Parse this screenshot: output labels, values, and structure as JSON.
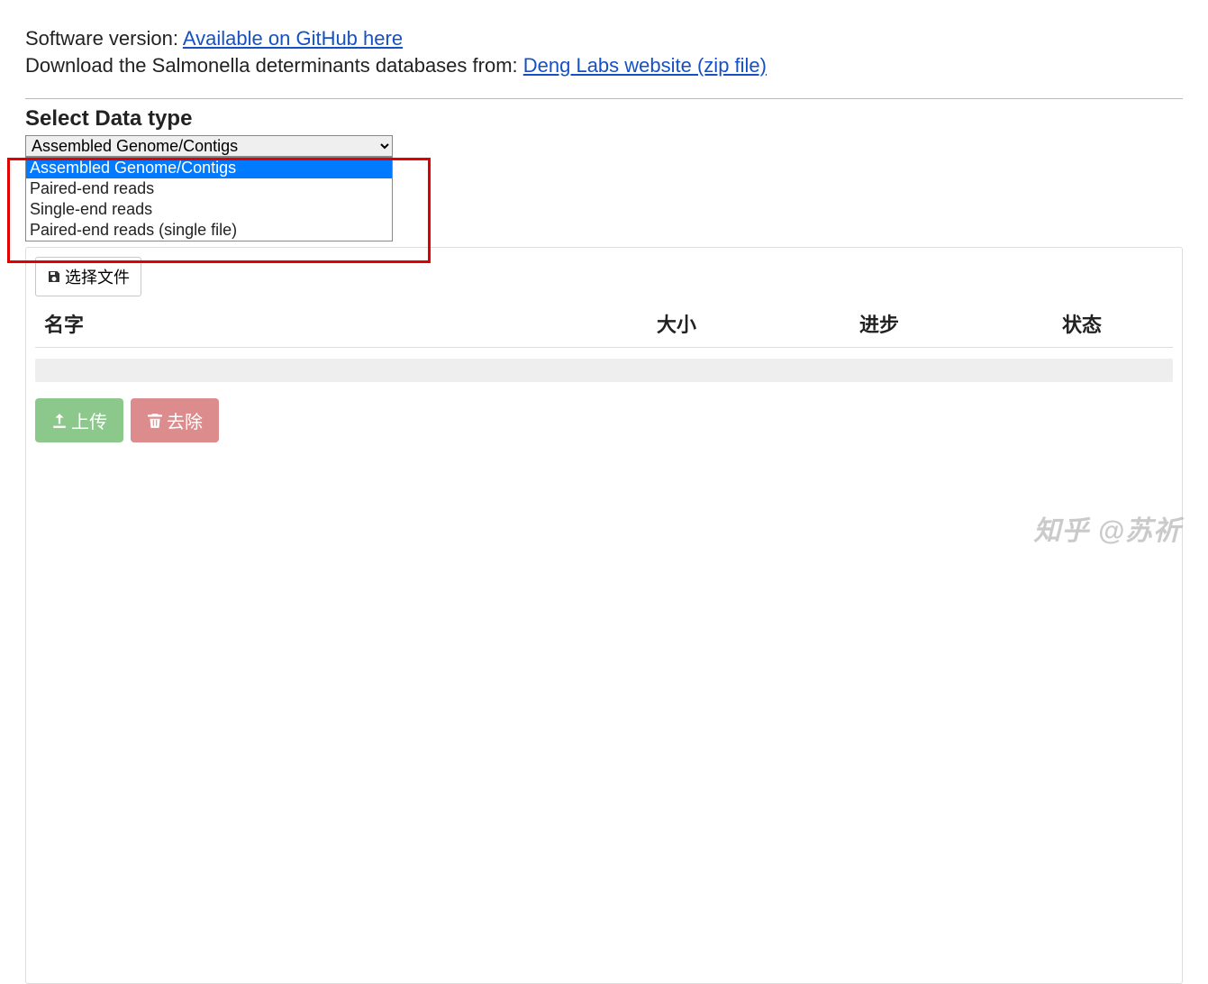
{
  "intro": {
    "version_label": "Software version: ",
    "version_link": "Available on GitHub here",
    "download_label": "Download the Salmonella determinants databases from: ",
    "download_link": "Deng Labs website (zip file)"
  },
  "datatype": {
    "title": "Select Data type",
    "selected": "Assembled Genome/Contigs",
    "options": [
      "Assembled Genome/Contigs",
      "Paired-end reads",
      "Single-end reads",
      "Paired-end reads (single file)"
    ]
  },
  "file_chooser": {
    "label": "选择文件"
  },
  "table": {
    "col_name": "名字",
    "col_size": "大小",
    "col_progress": "进步",
    "col_status": "状态"
  },
  "actions": {
    "upload": "上传",
    "remove": "去除"
  },
  "watermark": "知乎 @苏祈"
}
